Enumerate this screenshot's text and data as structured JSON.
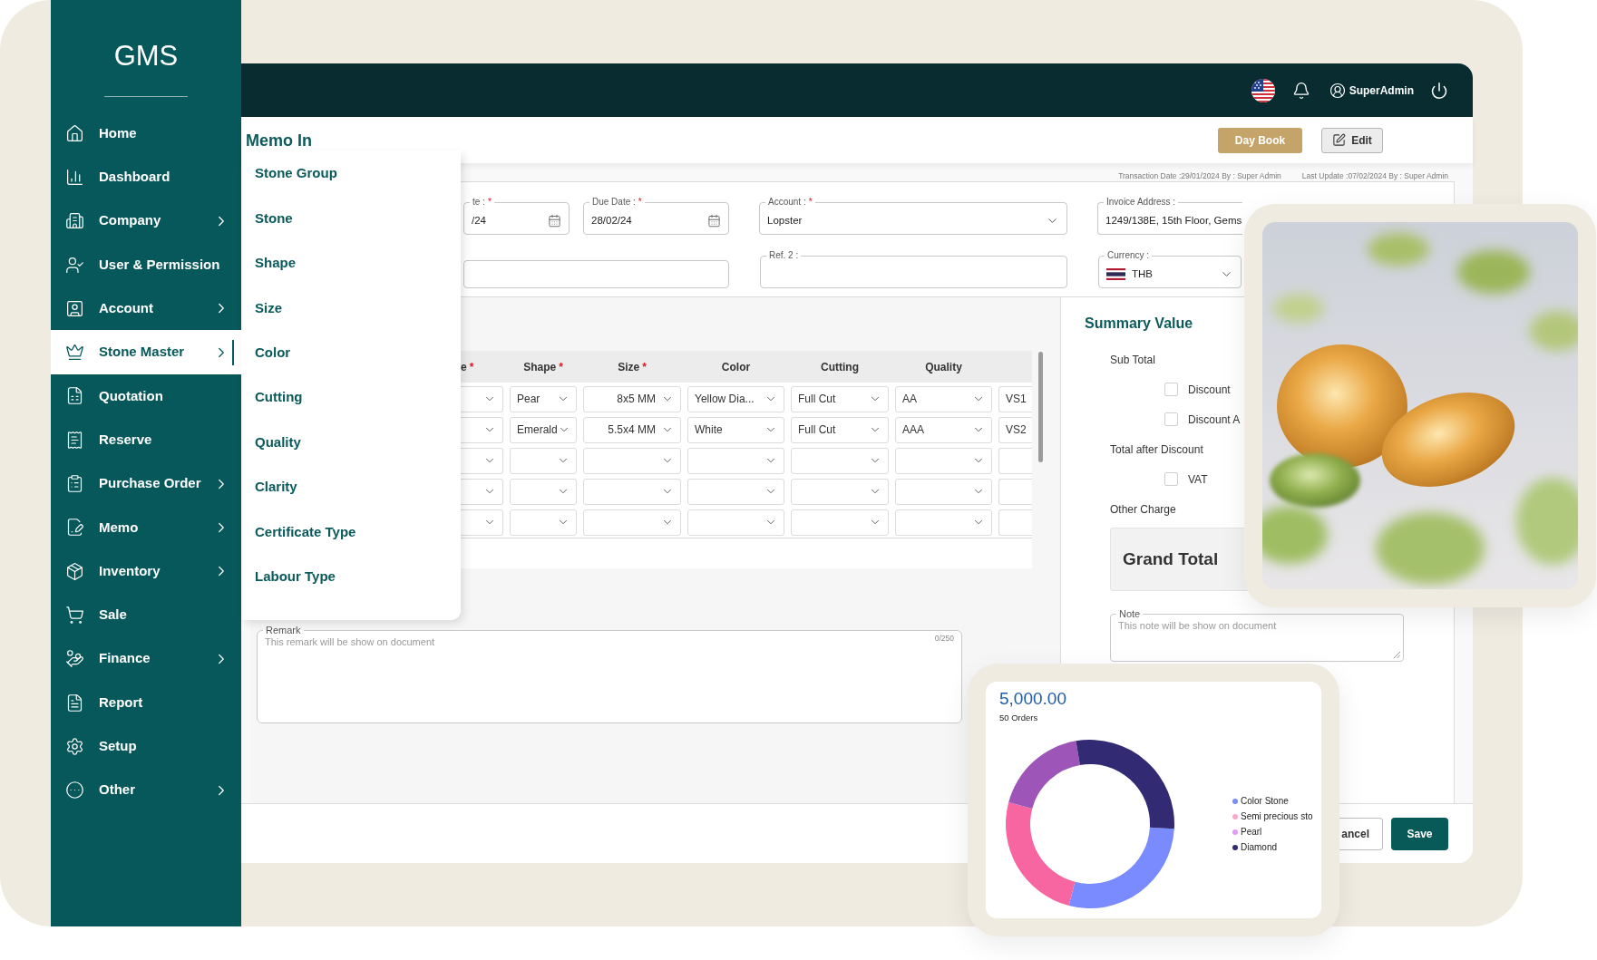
{
  "sidebar": {
    "logo": "GMS",
    "items": [
      {
        "label": "Home",
        "expandable": false,
        "selected": false
      },
      {
        "label": "Dashboard",
        "expandable": false,
        "selected": false
      },
      {
        "label": "Company",
        "expandable": true,
        "selected": false
      },
      {
        "label": "User & Permission",
        "expandable": false,
        "selected": false
      },
      {
        "label": "Account",
        "expandable": true,
        "selected": false
      },
      {
        "label": "Stone Master",
        "expandable": true,
        "selected": true
      },
      {
        "label": "Quotation",
        "expandable": false,
        "selected": false
      },
      {
        "label": "Reserve",
        "expandable": false,
        "selected": false
      },
      {
        "label": "Purchase Order",
        "expandable": true,
        "selected": false
      },
      {
        "label": "Memo",
        "expandable": true,
        "selected": false
      },
      {
        "label": "Inventory",
        "expandable": true,
        "selected": false
      },
      {
        "label": "Sale",
        "expandable": false,
        "selected": false
      },
      {
        "label": "Finance",
        "expandable": true,
        "selected": false
      },
      {
        "label": "Report",
        "expandable": false,
        "selected": false
      },
      {
        "label": "Setup",
        "expandable": false,
        "selected": false
      },
      {
        "label": "Other",
        "expandable": true,
        "selected": false
      }
    ]
  },
  "submenu": {
    "items": [
      "Stone Group",
      "Stone",
      "Shape",
      "Size",
      "Color",
      "Cutting",
      "Quality",
      "Clarity",
      "Certificate Type",
      "Labour Type"
    ]
  },
  "header": {
    "user": "SuperAdmin"
  },
  "page": {
    "title": "Memo In",
    "buttons": [
      {
        "label": "Day Book",
        "kind": "primary"
      },
      {
        "label": "Edit",
        "kind": "edit"
      }
    ]
  },
  "form": {
    "meta": [
      "Transaction Date :29/01/2024 By : Super Admin",
      "Last Update :07/02/2024 By : Super Admin"
    ],
    "fields": [
      {
        "kind": "date",
        "label": "te :",
        "required_mark": "*",
        "value": "/24"
      },
      {
        "kind": "date",
        "label": "Due Date :",
        "required_mark": "*",
        "value": "28/02/24"
      },
      {
        "kind": "select",
        "label": "Account :",
        "required_mark": "*",
        "value": "Lopster"
      },
      {
        "kind": "text",
        "label": "Invoice Address :",
        "value": "1249/138E, 15th Floor, Gems"
      },
      {
        "kind": "text"
      },
      {
        "kind": "text",
        "label": "Ref. 2 :"
      },
      {
        "kind": "currency",
        "label": "Currency :",
        "value": "THB"
      }
    ]
  },
  "table": {
    "columns": [
      {
        "label": "e",
        "required_mark": "*"
      },
      {
        "label": "Shape",
        "required_mark": "*"
      },
      {
        "label": "Size",
        "required_mark": "*"
      },
      {
        "label": "Color"
      },
      {
        "label": "Cutting"
      },
      {
        "label": "Quality"
      }
    ],
    "rows": [
      [
        null,
        "Pear",
        "8x5 MM",
        "Yellow Dia...",
        "Full Cut",
        "AA",
        "VS1"
      ],
      [
        null,
        "Emerald",
        "5.5x4 MM",
        "White",
        "Full Cut",
        "AAA",
        "VS2"
      ],
      [
        null,
        null,
        null,
        null,
        null,
        null,
        null
      ],
      [
        null,
        null,
        null,
        null,
        null,
        null,
        null
      ],
      [
        null,
        null,
        null,
        null,
        null,
        null,
        null
      ]
    ]
  },
  "remark": {
    "label": "Remark",
    "placeholder": "This remark will be show on document",
    "counter": "0/250"
  },
  "summary": {
    "title": "Summary Value",
    "lines": [
      {
        "kind": "label",
        "label": "Sub Total"
      },
      {
        "kind": "check",
        "label": "Discount",
        "checked": false
      },
      {
        "kind": "check",
        "label": "Discount A",
        "checked": false
      },
      {
        "kind": "label",
        "label": "Total after Discount"
      },
      {
        "kind": "check",
        "label": "VAT",
        "checked": false
      },
      {
        "kind": "label",
        "label": "Other Charge"
      }
    ],
    "grand_total": "Grand Total",
    "note": {
      "label": "Note",
      "placeholder": "This note will be show on document"
    }
  },
  "footer": {
    "buttons": [
      {
        "label": "ancel",
        "kind": "secondary"
      },
      {
        "label": "Save",
        "kind": "primary"
      }
    ]
  },
  "chart_card": {
    "amount": "5,000.00",
    "orders": "50 Orders",
    "legend": [
      {
        "label": "Color Stone",
        "color": "#7b8cfb"
      },
      {
        "label": "Semi precious sto",
        "color": "#f8a9c8"
      },
      {
        "label": "Pearl",
        "color": "#e39af5"
      },
      {
        "label": "Diamond",
        "color": "#2f2a72"
      }
    ]
  }
}
